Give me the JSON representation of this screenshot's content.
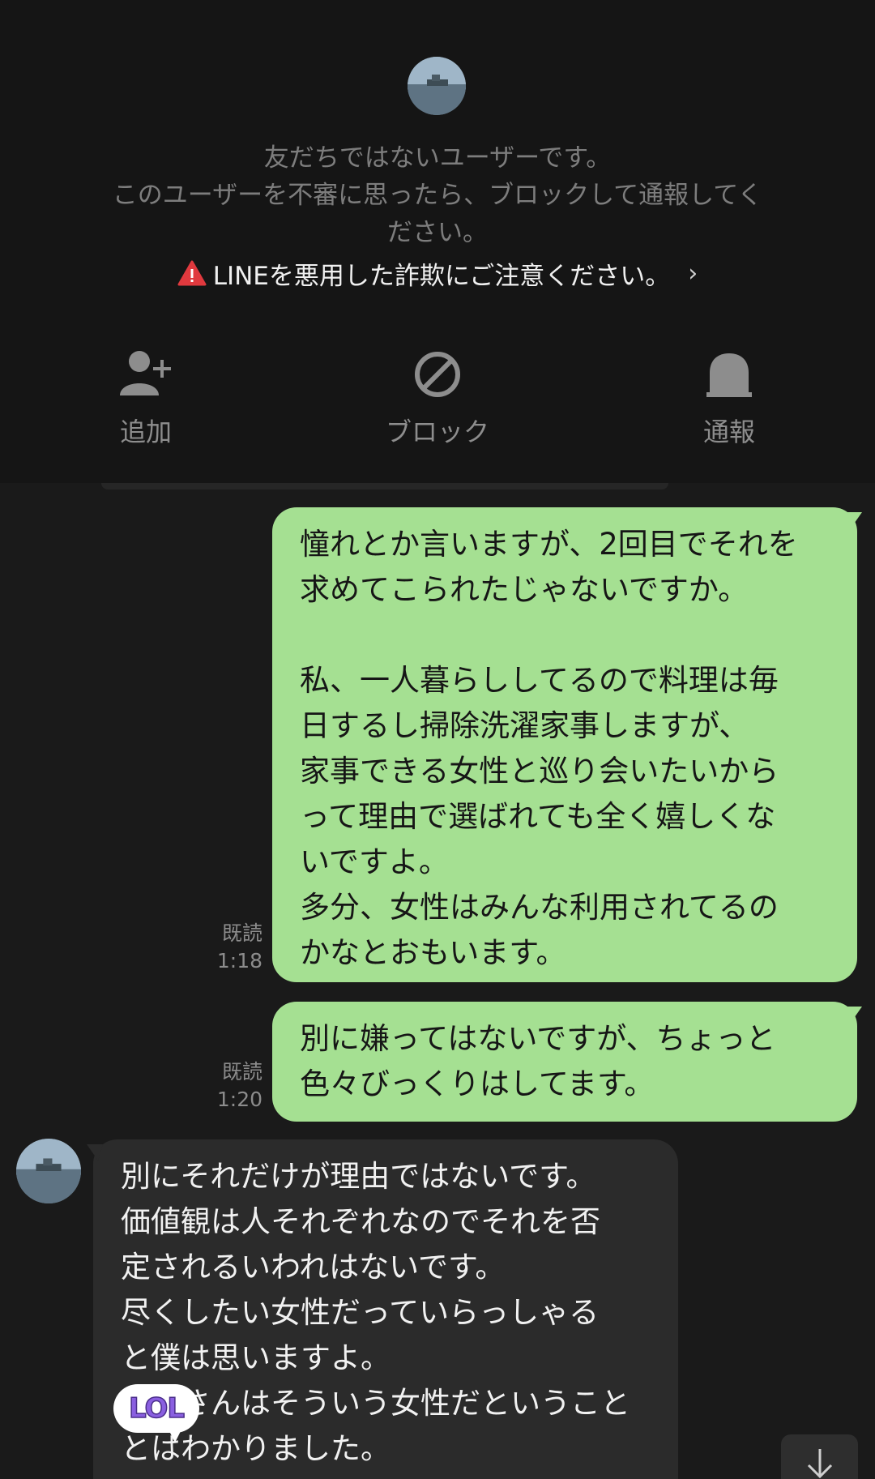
{
  "header": {
    "notice_lines": [
      "友だちではないユーザーです。",
      "このユーザーを不審に思ったら、ブロックして通報してく",
      "ださい。"
    ],
    "fraud_warning": "LINEを悪用した詐欺にご注意ください。",
    "chevron": "›",
    "actions": {
      "add_label": "追加",
      "block_label": "ブロック",
      "report_label": "通報"
    }
  },
  "messages": [
    {
      "side": "out",
      "text": "憧れとか言いますが、2回目でそれを\n求めてこられたじゃないですか。\n\n私、一人暮らししてるので料理は毎\n日するし掃除洗濯家事しますが、\n家事できる女性と巡り会いたいから\nって理由で選ばれても全く嬉しくな\nいですよ。\n多分、女性はみんな利用されてるの\nかなとおもいます。",
      "read": "既読",
      "time": "1:18"
    },
    {
      "side": "out",
      "text": "別に嫌ってはないですが、ちょっと\n色々びっくりはしてます。",
      "read": "既読",
      "time": "1:20"
    },
    {
      "side": "in",
      "text": "別にそれだけが理由ではないです。\n価値観は人それぞれなのでそれを否\n定されるいわれはないです。\n尽くしたい女性だっていらっしゃる\nと僕は思いますよ。\n　　さんはそういう女性だということ\nとはわかりました。"
    }
  ],
  "sticker": {
    "text": "LOL"
  },
  "icons": {
    "add": "add-friend-icon",
    "block": "block-icon",
    "report": "report-bell-icon",
    "warning": "warning-triangle-icon",
    "scroll": "arrow-down-icon"
  },
  "colors": {
    "outgoing_bubble": "#a5e092",
    "incoming_bubble": "#2b2b2b",
    "background": "#1a1a1a",
    "warning_red": "#e0393e"
  }
}
